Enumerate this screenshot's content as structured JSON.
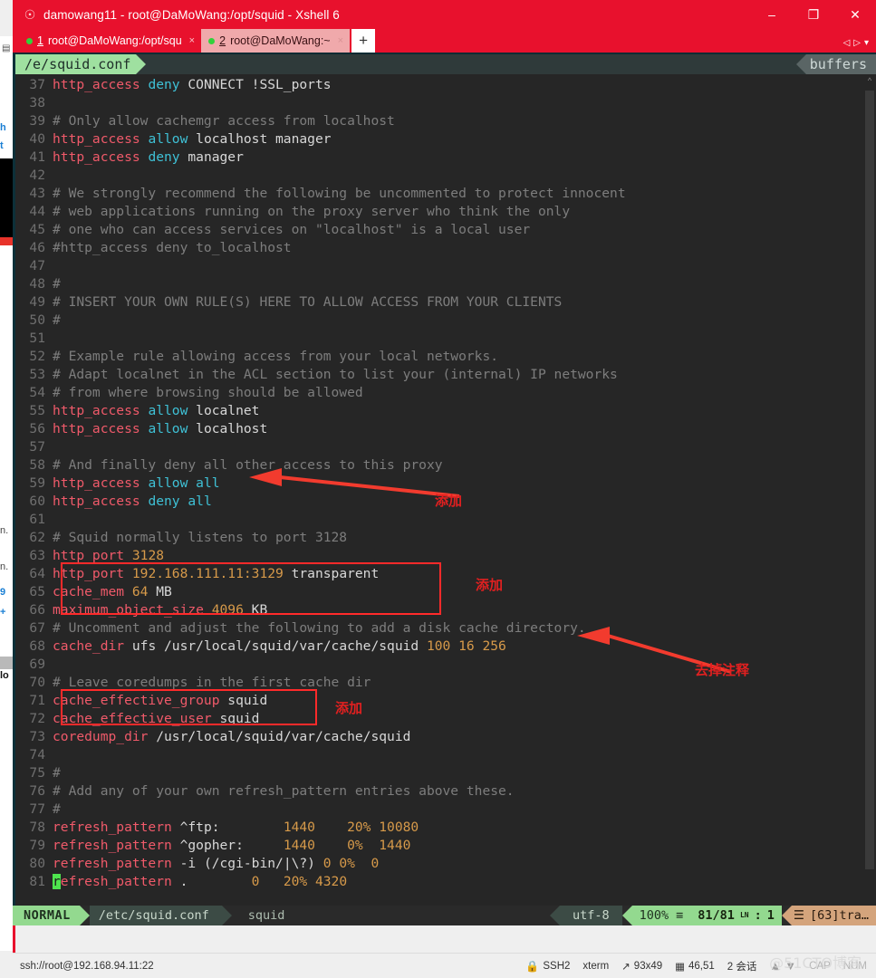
{
  "window": {
    "title": "damowang11 - root@DaMoWang:/opt/squid - Xshell 6",
    "app_icon": "xshell-logo-icon",
    "minimize": "–",
    "maximize": "❐",
    "close": "✕"
  },
  "tabs": [
    {
      "num": "1",
      "label": "root@DaMoWang:/opt/squ",
      "close": "×",
      "state": "active"
    },
    {
      "num": "2",
      "label": "root@DaMoWang:~",
      "close": "×",
      "state": "inactive"
    }
  ],
  "tab_new_label": "+",
  "vim_tabline": {
    "buffer_name": "/e/squid.conf",
    "right_label": "buffers"
  },
  "editor": {
    "lines": [
      {
        "n": "37",
        "parts": [
          {
            "t": "http_access ",
            "c": "kw"
          },
          {
            "t": "deny ",
            "c": "kw2"
          },
          {
            "t": "CONNECT !SSL_ports",
            "c": "txt"
          }
        ]
      },
      {
        "n": "38",
        "parts": []
      },
      {
        "n": "39",
        "parts": [
          {
            "t": "# Only allow cachemgr access from localhost",
            "c": "cmt"
          }
        ]
      },
      {
        "n": "40",
        "parts": [
          {
            "t": "http_access ",
            "c": "kw"
          },
          {
            "t": "allow ",
            "c": "kw2"
          },
          {
            "t": "localhost manager",
            "c": "txt"
          }
        ]
      },
      {
        "n": "41",
        "parts": [
          {
            "t": "http_access ",
            "c": "kw"
          },
          {
            "t": "deny ",
            "c": "kw2"
          },
          {
            "t": "manager",
            "c": "txt"
          }
        ]
      },
      {
        "n": "42",
        "parts": []
      },
      {
        "n": "43",
        "parts": [
          {
            "t": "# We strongly recommend the following be uncommented to protect innocent",
            "c": "cmt"
          }
        ]
      },
      {
        "n": "44",
        "parts": [
          {
            "t": "# web applications running on the proxy server who think the only",
            "c": "cmt"
          }
        ]
      },
      {
        "n": "45",
        "parts": [
          {
            "t": "# one who can access services on \"localhost\" is a local user",
            "c": "cmt"
          }
        ]
      },
      {
        "n": "46",
        "parts": [
          {
            "t": "#http_access deny to_localhost",
            "c": "cmt"
          }
        ]
      },
      {
        "n": "47",
        "parts": []
      },
      {
        "n": "48",
        "parts": [
          {
            "t": "#",
            "c": "cmt"
          }
        ]
      },
      {
        "n": "49",
        "parts": [
          {
            "t": "# INSERT YOUR OWN RULE(S) HERE TO ALLOW ACCESS FROM YOUR CLIENTS",
            "c": "cmt"
          }
        ]
      },
      {
        "n": "50",
        "parts": [
          {
            "t": "#",
            "c": "cmt"
          }
        ]
      },
      {
        "n": "51",
        "parts": []
      },
      {
        "n": "52",
        "parts": [
          {
            "t": "# Example rule allowing access from your local networks.",
            "c": "cmt"
          }
        ]
      },
      {
        "n": "53",
        "parts": [
          {
            "t": "# Adapt localnet in the ACL section to list your (internal) IP networks",
            "c": "cmt"
          }
        ]
      },
      {
        "n": "54",
        "parts": [
          {
            "t": "# from where browsing should be allowed",
            "c": "cmt"
          }
        ]
      },
      {
        "n": "55",
        "parts": [
          {
            "t": "http_access ",
            "c": "kw"
          },
          {
            "t": "allow ",
            "c": "kw2"
          },
          {
            "t": "localnet",
            "c": "txt"
          }
        ]
      },
      {
        "n": "56",
        "parts": [
          {
            "t": "http_access ",
            "c": "kw"
          },
          {
            "t": "allow ",
            "c": "kw2"
          },
          {
            "t": "localhost",
            "c": "txt"
          }
        ]
      },
      {
        "n": "57",
        "parts": []
      },
      {
        "n": "58",
        "parts": [
          {
            "t": "# And finally deny all other access to this proxy",
            "c": "cmt"
          }
        ]
      },
      {
        "n": "59",
        "parts": [
          {
            "t": "http_access ",
            "c": "kw"
          },
          {
            "t": "allow ",
            "c": "kw2"
          },
          {
            "t": "all",
            "c": "kw2"
          }
        ]
      },
      {
        "n": "60",
        "parts": [
          {
            "t": "http_access ",
            "c": "kw"
          },
          {
            "t": "deny ",
            "c": "kw2"
          },
          {
            "t": "all",
            "c": "kw2"
          }
        ]
      },
      {
        "n": "61",
        "parts": []
      },
      {
        "n": "62",
        "parts": [
          {
            "t": "# Squid normally listens to port 3128",
            "c": "cmt"
          }
        ]
      },
      {
        "n": "63",
        "parts": [
          {
            "t": "http_port ",
            "c": "kw"
          },
          {
            "t": "3128",
            "c": "val"
          }
        ]
      },
      {
        "n": "64",
        "parts": [
          {
            "t": "http_port ",
            "c": "kw"
          },
          {
            "t": "192.168.111.11:3129",
            "c": "val"
          },
          {
            "t": " transparent",
            "c": "txt"
          }
        ]
      },
      {
        "n": "65",
        "parts": [
          {
            "t": "cache_mem ",
            "c": "kw"
          },
          {
            "t": "64",
            "c": "val"
          },
          {
            "t": " MB",
            "c": "txt"
          }
        ]
      },
      {
        "n": "66",
        "parts": [
          {
            "t": "maximum_object_size ",
            "c": "kw"
          },
          {
            "t": "4096",
            "c": "val"
          },
          {
            "t": " KB",
            "c": "txt"
          }
        ]
      },
      {
        "n": "67",
        "parts": [
          {
            "t": "# Uncomment and adjust the following to add a disk cache directory.",
            "c": "cmt"
          }
        ]
      },
      {
        "n": "68",
        "parts": [
          {
            "t": "cache_dir ",
            "c": "kw"
          },
          {
            "t": "ufs /usr/local/squid/var/cache/squid ",
            "c": "txt"
          },
          {
            "t": "100 16 256",
            "c": "val"
          }
        ]
      },
      {
        "n": "69",
        "parts": []
      },
      {
        "n": "70",
        "parts": [
          {
            "t": "# Leave coredumps in the first cache dir",
            "c": "cmt"
          }
        ]
      },
      {
        "n": "71",
        "parts": [
          {
            "t": "cache_effective_group ",
            "c": "kw"
          },
          {
            "t": "squid",
            "c": "txt"
          }
        ]
      },
      {
        "n": "72",
        "parts": [
          {
            "t": "cache_effective_user ",
            "c": "kw"
          },
          {
            "t": "squid",
            "c": "txt"
          }
        ]
      },
      {
        "n": "73",
        "parts": [
          {
            "t": "coredump_dir ",
            "c": "kw"
          },
          {
            "t": "/usr/local/squid/var/cache/squid",
            "c": "txt"
          }
        ]
      },
      {
        "n": "74",
        "parts": []
      },
      {
        "n": "75",
        "parts": [
          {
            "t": "#",
            "c": "cmt"
          }
        ]
      },
      {
        "n": "76",
        "parts": [
          {
            "t": "# Add any of your own refresh_pattern entries above these.",
            "c": "cmt"
          }
        ]
      },
      {
        "n": "77",
        "parts": [
          {
            "t": "#",
            "c": "cmt"
          }
        ]
      },
      {
        "n": "78",
        "parts": [
          {
            "t": "refresh_pattern ",
            "c": "kw"
          },
          {
            "t": "^ftp:",
            "c": "txt"
          },
          {
            "t": "        1440    20% 10080",
            "c": "val"
          }
        ]
      },
      {
        "n": "79",
        "parts": [
          {
            "t": "refresh_pattern ",
            "c": "kw"
          },
          {
            "t": "^gopher:",
            "c": "txt"
          },
          {
            "t": "     1440    0%  1440",
            "c": "val"
          }
        ]
      },
      {
        "n": "80",
        "parts": [
          {
            "t": "refresh_pattern ",
            "c": "kw"
          },
          {
            "t": "-i (/cgi-bin/|\\?) ",
            "c": "txt"
          },
          {
            "t": "0 0%  0",
            "c": "val"
          }
        ]
      },
      {
        "n": "81",
        "parts": [
          {
            "t": "r",
            "c": "cursor"
          },
          {
            "t": "efresh_pattern ",
            "c": "kw"
          },
          {
            "t": ". ",
            "c": "txt"
          },
          {
            "t": "       0   20% 4320",
            "c": "val"
          }
        ]
      }
    ]
  },
  "annotations": [
    {
      "id": "anno-add-1",
      "text": "添加"
    },
    {
      "id": "anno-add-2",
      "text": "添加"
    },
    {
      "id": "anno-remove-comment",
      "text": "去掉注释"
    },
    {
      "id": "anno-add-3",
      "text": "添加"
    }
  ],
  "statusline": {
    "mode": "NORMAL",
    "file": "/etc/squid.conf",
    "filetype": "squid",
    "encoding": "utf-8",
    "percent": "100%",
    "percent_icon": "≡",
    "position": "81/81",
    "line_col_icon": "LN",
    "colon": ":",
    "column": "1",
    "tag_icon": "☰",
    "tag": "[63]tra…"
  },
  "xshell_status": {
    "connection": "ssh://root@192.168.94.11:22",
    "lock_icon": "lock-icon",
    "protocol": "SSH2",
    "terminal_type": "xterm",
    "size_icon": "resize-icon",
    "size": "93x49",
    "cursor_icon": "cursor-pos-icon",
    "cursor_pos": "46,51",
    "sessions": "2 会话",
    "up_icon": "▲",
    "down_icon": "▼",
    "caps": "CAP",
    "num": "NUM"
  },
  "watermark": "@51CTO博客",
  "colors": {
    "brand_red": "#e8112d",
    "terminal_bg": "#262626",
    "annotation_red": "#ff2a2a",
    "accent_green": "#93d98f",
    "keyword_red": "#f05a6a",
    "keyword_cyan": "#3fc1d6",
    "value_orange": "#d79a4a"
  }
}
